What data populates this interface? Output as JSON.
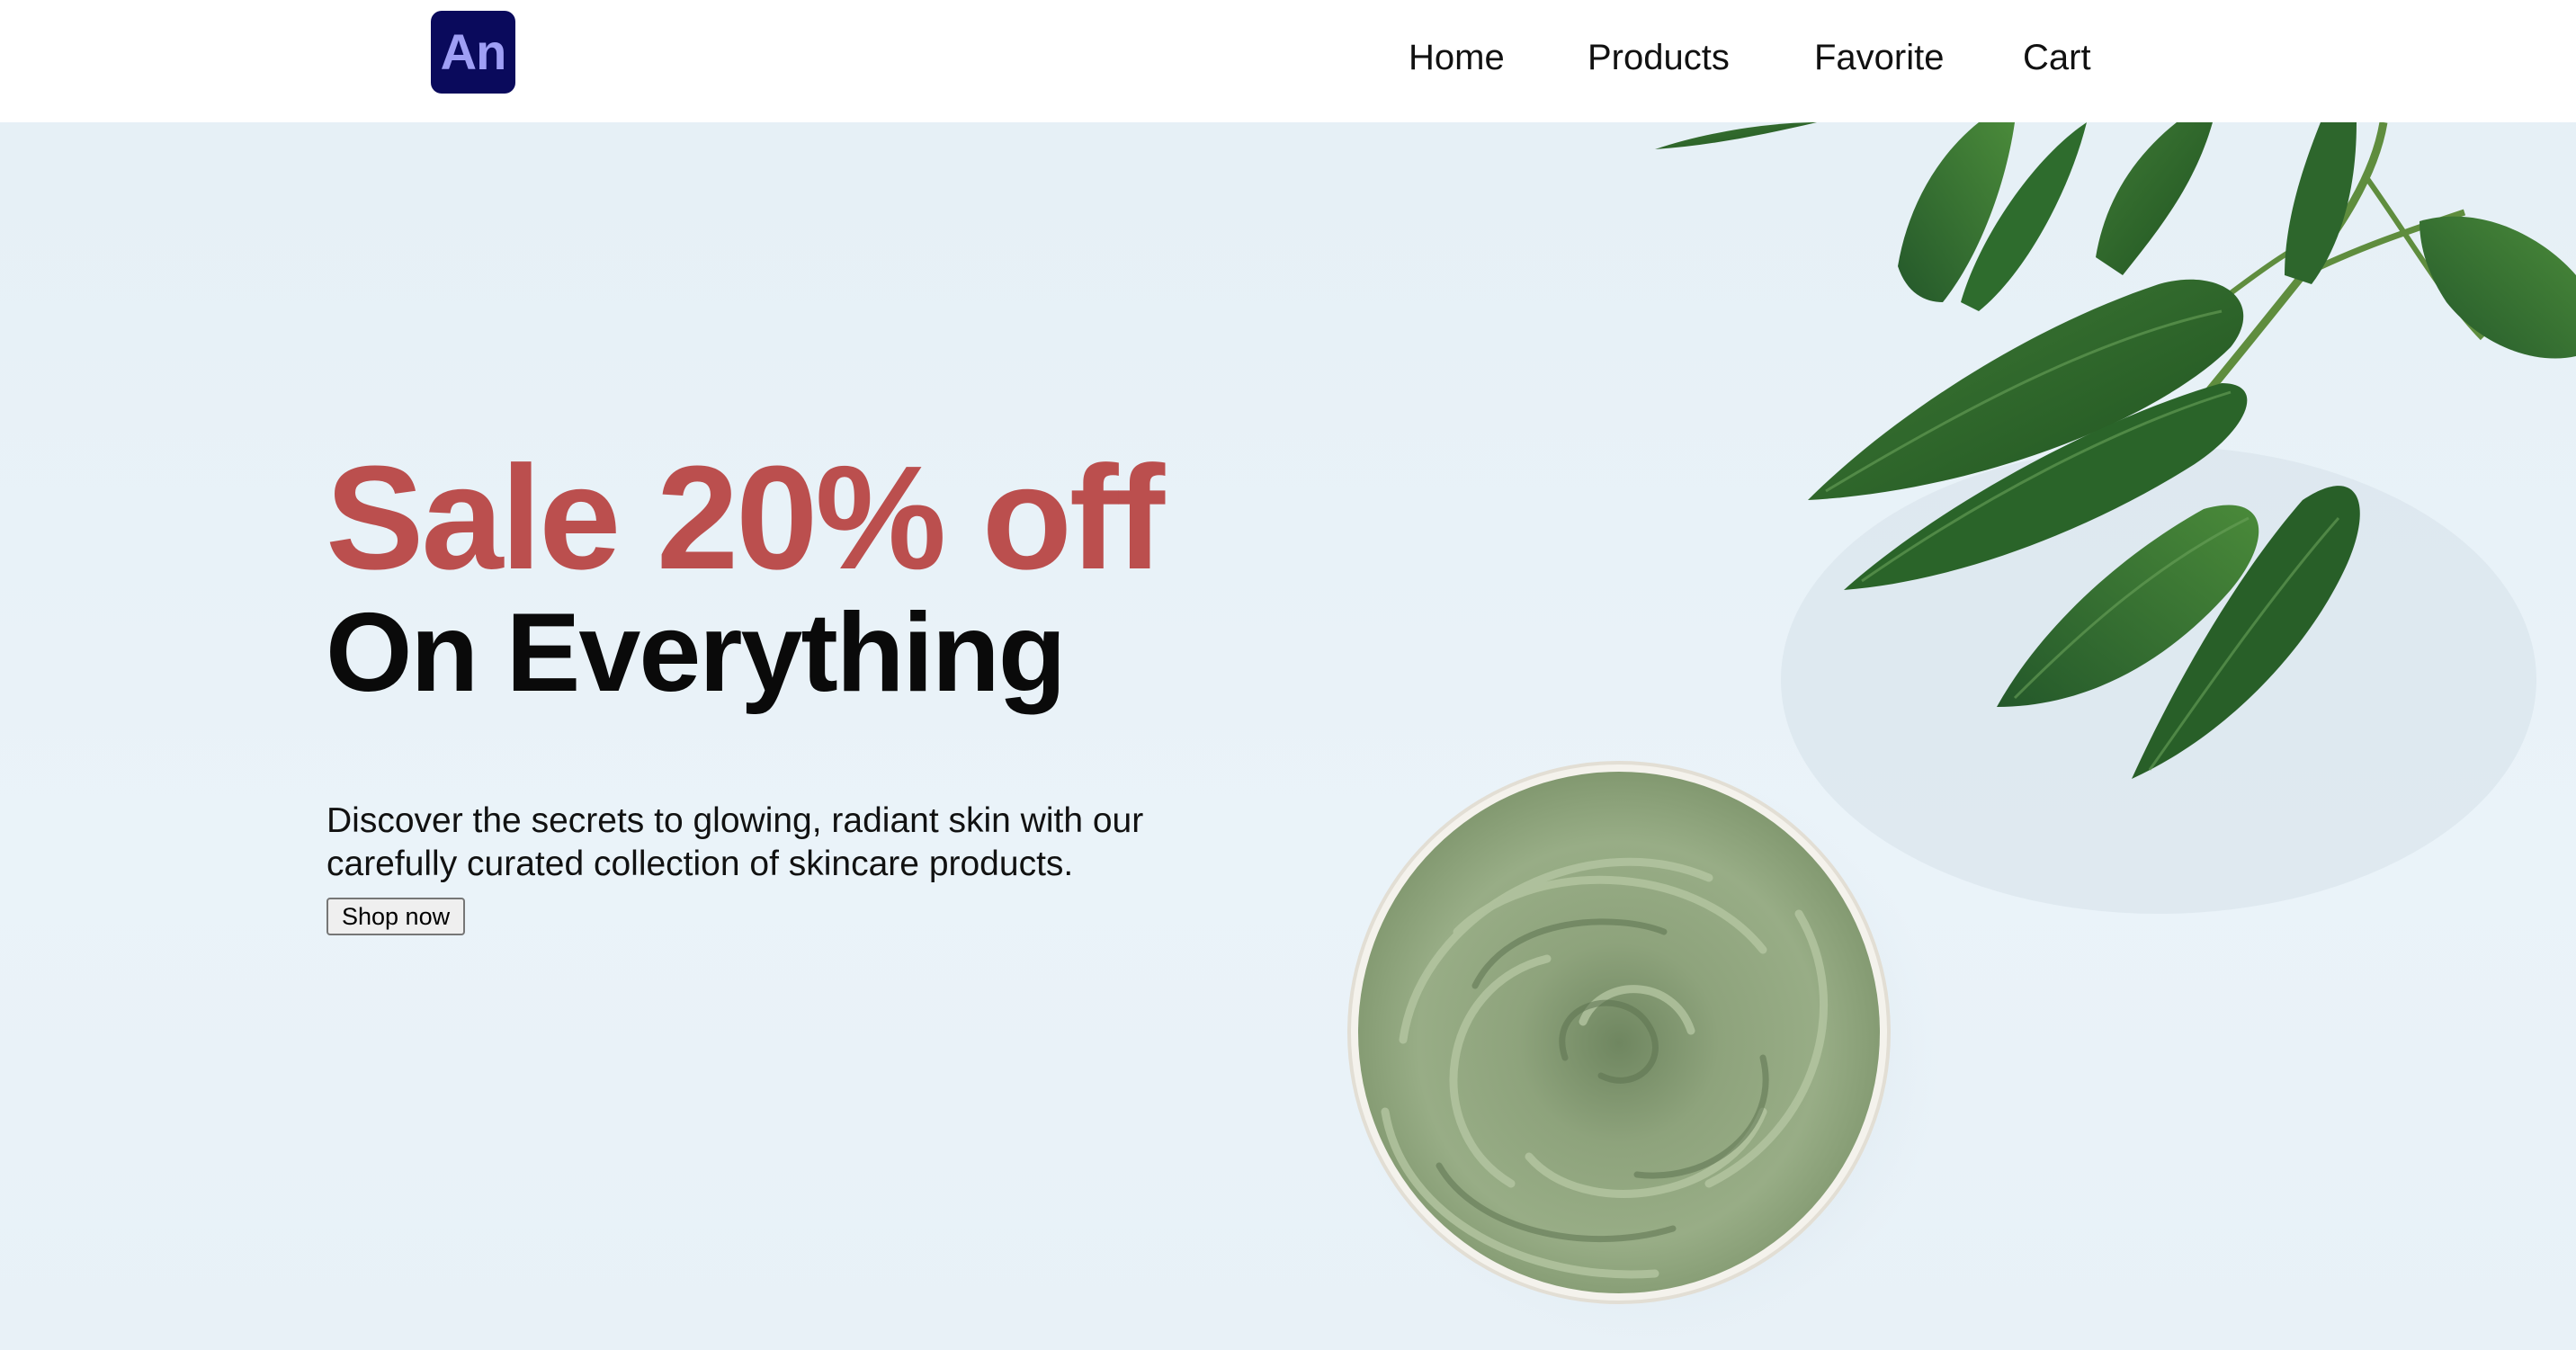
{
  "header": {
    "logo_text": "An",
    "nav": [
      {
        "label": "Home"
      },
      {
        "label": "Products"
      },
      {
        "label": "Favorite"
      },
      {
        "label": "Cart"
      }
    ]
  },
  "hero": {
    "sale_text": "Sale 20% off",
    "title": "On Everything",
    "description": "Discover the secrets to glowing, radiant skin with our carefully curated collection of skincare products.",
    "cta_label": "Shop now"
  },
  "colors": {
    "logo_bg": "#0a0a5c",
    "logo_text": "#9f9ff5",
    "sale_red": "#bb4f4e",
    "hero_bg": "#e8f1f7",
    "clay_green": "#8fa27a",
    "leaf_green": "#2f6a2c"
  }
}
